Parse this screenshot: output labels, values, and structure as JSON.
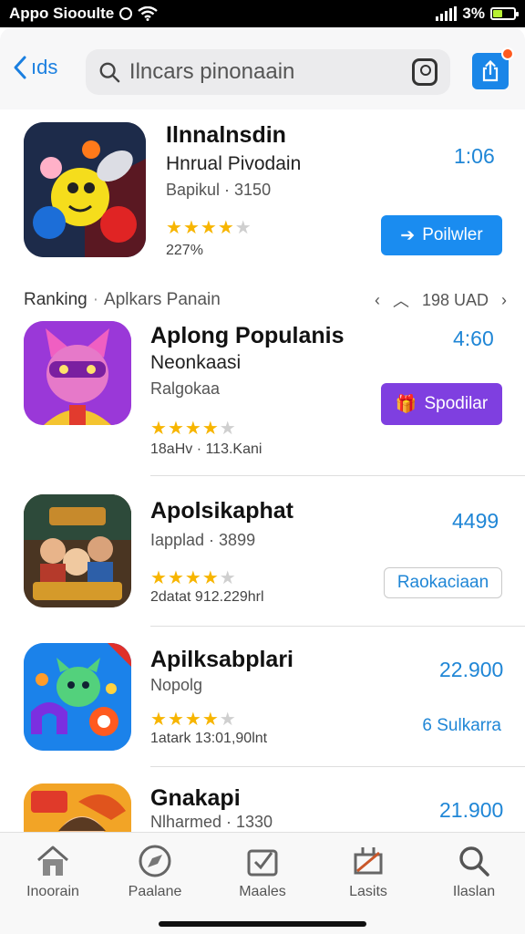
{
  "status_bar": {
    "app_name": "Appo Siooulte",
    "battery": "3%"
  },
  "header": {
    "back_label": "ıds",
    "search_placeholder": "Ilncars pinonaain"
  },
  "ranking": {
    "label": "Ranking",
    "sublabel": "Aplkars Panain",
    "count": "198 UAD"
  },
  "apps": [
    {
      "title": "Ilnnalnsdin",
      "subtitle": "Hnrual Pivodain",
      "meta": "Bapikul · 3150",
      "price": "1:06",
      "rating": 4,
      "reviews": "227%",
      "button_label": "Poilwler",
      "button_style": "blue"
    },
    {
      "title": "Aplong Populanis",
      "subtitle": "Neonkaasi",
      "meta": "Ralgokaa",
      "price": "4:60",
      "rating": 4,
      "reviews": "18aHv · 113.Kani",
      "button_label": "Spodilar",
      "button_style": "purple"
    },
    {
      "title": "Apolsikaphat",
      "subtitle": "",
      "meta": "Iapplad · 3899",
      "price": "4499",
      "rating": 4,
      "reviews": "2datat  912.229hrl",
      "button_label": "Raokaciaan",
      "button_style": "outline"
    },
    {
      "title": "Apilksabplari",
      "subtitle": "",
      "meta": "Nopolg",
      "price": "22.900",
      "rating": 4,
      "reviews": "1atark   13:01,90lnt",
      "button_label": "6 Sulkarra",
      "button_style": "link"
    },
    {
      "title": "Gnakapi",
      "subtitle": "",
      "meta": "Nlharmed · 1330",
      "price": "21.900",
      "rating": 0,
      "reviews": "",
      "button_label": "",
      "button_style": "none"
    }
  ],
  "tabs": [
    {
      "label": "Inoorain",
      "icon": "home-icon"
    },
    {
      "label": "Paalane",
      "icon": "compass-icon"
    },
    {
      "label": "Maales",
      "icon": "apps-icon"
    },
    {
      "label": "Lasits",
      "icon": "arcade-icon"
    },
    {
      "label": "Ilaslan",
      "icon": "search-icon"
    }
  ],
  "colors": {
    "accent": "#1a86e8",
    "purple": "#7f3fe0",
    "price": "#1f86d6",
    "star": "#f7b500"
  }
}
